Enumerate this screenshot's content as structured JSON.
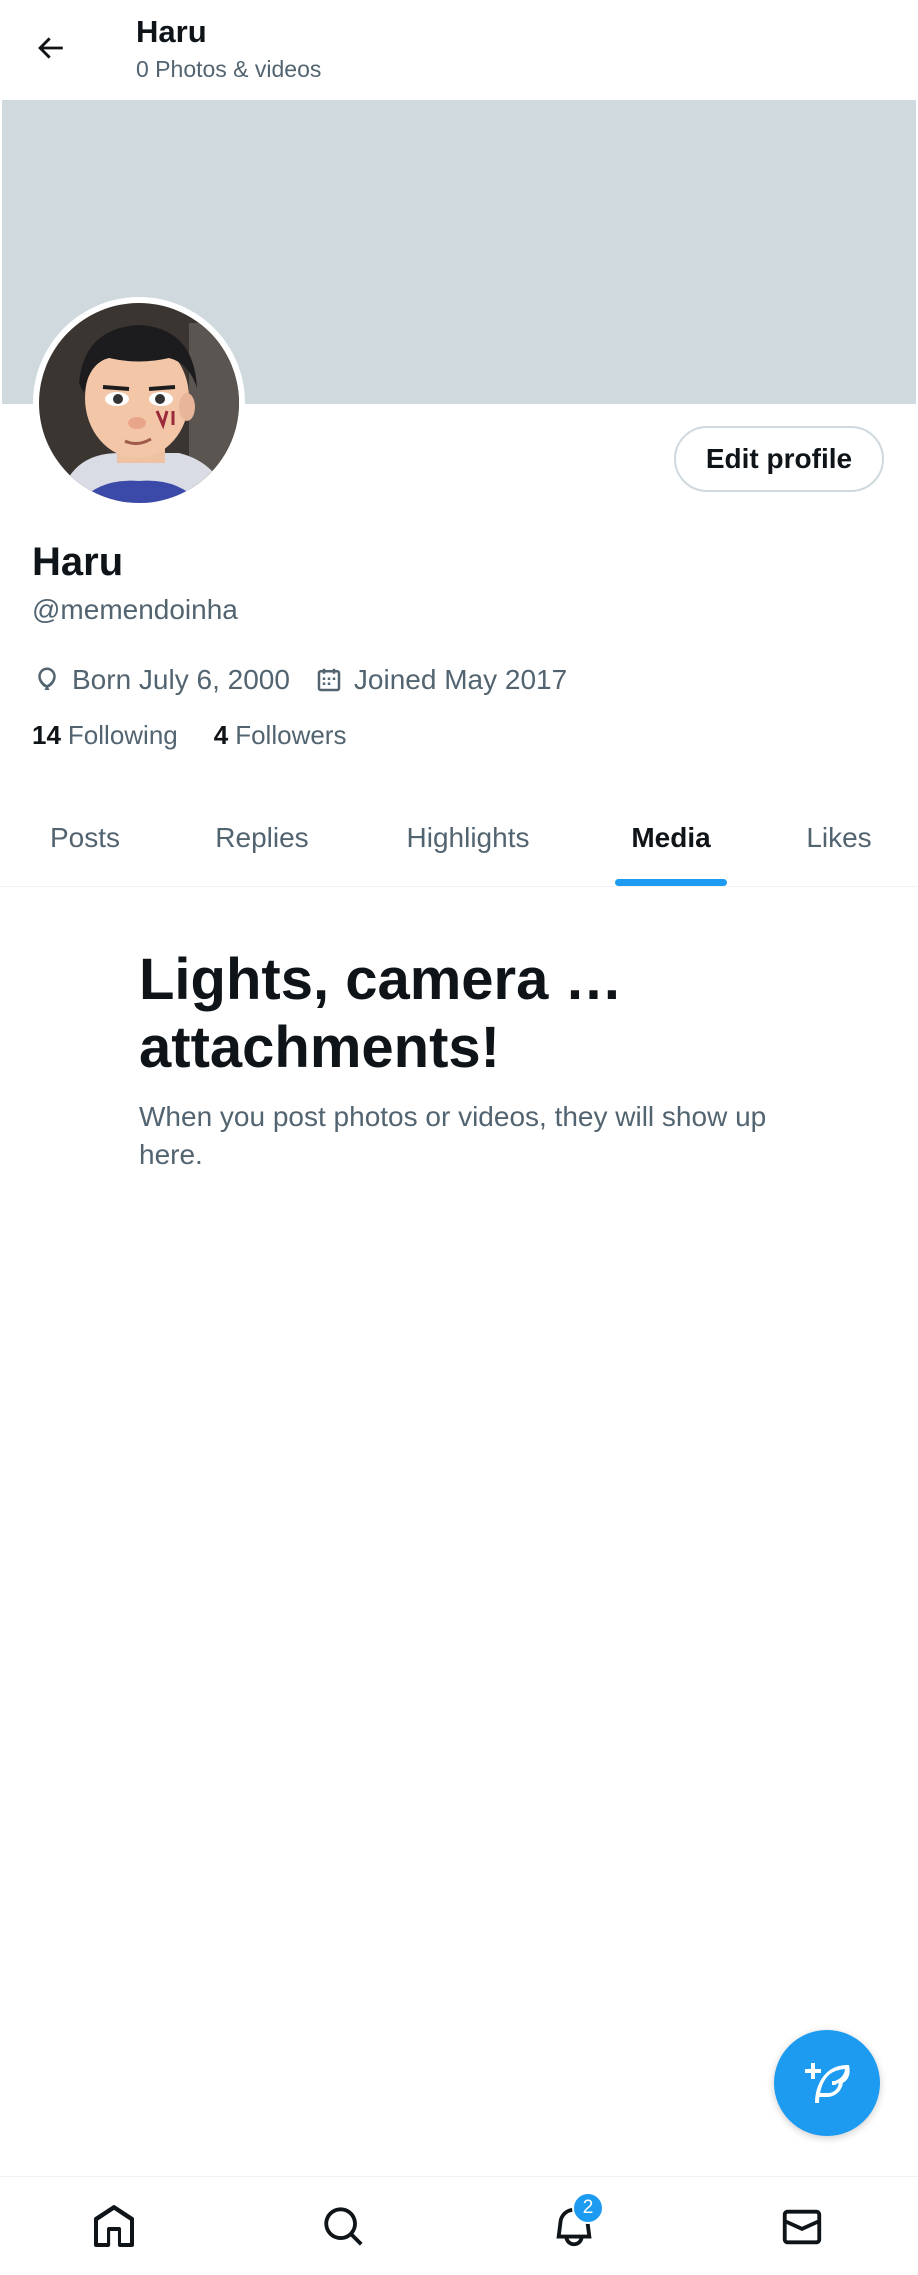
{
  "header": {
    "title": "Haru",
    "subtitle": "0 Photos & videos"
  },
  "profile": {
    "edit_label": "Edit profile",
    "name": "Haru",
    "handle": "@memendoinha",
    "birth": "Born July 6, 2000",
    "joined": "Joined May 2017",
    "following_count": "14",
    "following_label": "Following",
    "followers_count": "4",
    "followers_label": "Followers"
  },
  "tabs": [
    {
      "label": "Posts",
      "active": false
    },
    {
      "label": "Replies",
      "active": false
    },
    {
      "label": "Highlights",
      "active": false
    },
    {
      "label": "Media",
      "active": true
    },
    {
      "label": "Likes",
      "active": false
    }
  ],
  "empty_state": {
    "title": "Lights, camera … attachments!",
    "subtitle": "When you post photos or videos, they will show up here."
  },
  "bottom_nav": {
    "items": [
      "home-icon",
      "search-icon",
      "bell-icon",
      "mail-icon"
    ],
    "notification_badge": "2"
  },
  "colors": {
    "accent": "#1d9bf0",
    "banner": "#cfd9de",
    "secondary_text": "#536471"
  }
}
